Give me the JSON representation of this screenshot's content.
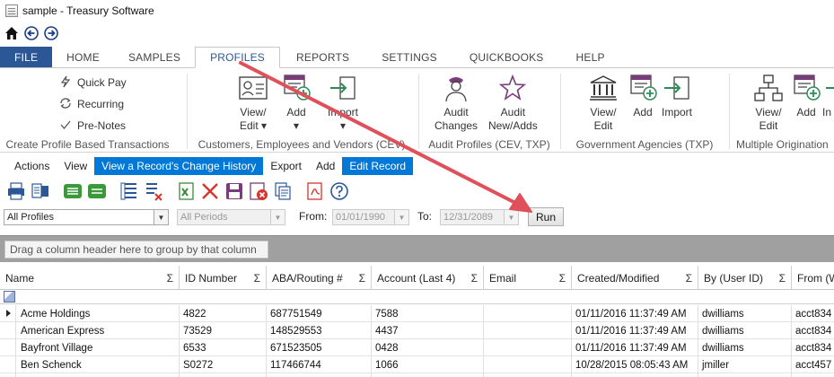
{
  "window": {
    "title": "sample - Treasury Software"
  },
  "ribbon_tabs": [
    "FILE",
    "HOME",
    "SAMPLES",
    "PROFILES",
    "REPORTS",
    "SETTINGS",
    "QUICKBOOKS",
    "HELP"
  ],
  "ribbon": {
    "create_group": {
      "items": [
        "Quick Pay",
        "Recurring",
        "Pre-Notes"
      ],
      "label": "Create Profile Based Transactions"
    },
    "cev_group": {
      "buttons": [
        {
          "l1": "View/",
          "l2": "Edit ▾"
        },
        {
          "l1": "Add",
          "l2": "▾"
        },
        {
          "l1": "Import",
          "l2": "▾"
        }
      ],
      "label": "Customers, Employees and Vendors (CEV)"
    },
    "audit_group": {
      "buttons": [
        {
          "l1": "Audit",
          "l2": "Changes"
        },
        {
          "l1": "Audit",
          "l2": "New/Adds"
        }
      ],
      "label": "Audit Profiles (CEV, TXP)"
    },
    "gov_group": {
      "buttons": [
        {
          "l1": "View/",
          "l2": "Edit"
        },
        {
          "l1": "Add",
          "l2": ""
        },
        {
          "l1": "Import",
          "l2": ""
        }
      ],
      "label": "Government Agencies (TXP)"
    },
    "multi_group": {
      "buttons": [
        {
          "l1": "View/",
          "l2": "Edit"
        },
        {
          "l1": "Add",
          "l2": ""
        },
        {
          "l1": "In",
          "l2": ""
        }
      ],
      "label": "Multiple Origination"
    }
  },
  "action_bar": [
    {
      "label": "Actions",
      "highlight": false
    },
    {
      "label": "View",
      "highlight": false
    },
    {
      "label": "View a Record's Change History",
      "highlight": true
    },
    {
      "label": "Export",
      "highlight": false
    },
    {
      "label": "Add",
      "highlight": false
    },
    {
      "label": "Edit Record",
      "highlight": true
    }
  ],
  "filters": {
    "profile_select": "All Profiles",
    "period_select": "All Periods",
    "from_label": "From:",
    "from_date": "01/01/1990",
    "to_label": "To:",
    "to_date": "12/31/2089",
    "run_label": "Run"
  },
  "grid": {
    "group_hint": "Drag a column header here to group by that column",
    "columns": [
      "Name",
      "ID Number",
      "ABA/Routing #",
      "Account (Last 4)",
      "Email",
      "Created/Modified",
      "By (User ID)",
      "From (W"
    ],
    "sigma": "Σ",
    "rows": [
      [
        "Acme Holdings",
        "4822",
        "687751549",
        "7588",
        "",
        "01/11/2016 11:37:49 AM",
        "dwilliams",
        "acct834"
      ],
      [
        "American Express",
        "73529",
        "148529553",
        "4437",
        "",
        "01/11/2016 11:37:49 AM",
        "dwilliams",
        "acct834"
      ],
      [
        "Bayfront Village",
        "6533",
        "671523505",
        "0428",
        "",
        "01/11/2016 11:37:49 AM",
        "dwilliams",
        "acct834"
      ],
      [
        "Ben Schenck",
        "S0272",
        "117466744",
        "1066",
        "",
        "10/28/2015 08:05:43 AM",
        "jmiller",
        "acct457"
      ],
      [
        "",
        "",
        "",
        "",
        "",
        "",
        "",
        ""
      ]
    ]
  },
  "colors": {
    "file_tab": "#2b5797",
    "highlight": "#0078d7",
    "annotation_arrow": "#e0505a"
  }
}
